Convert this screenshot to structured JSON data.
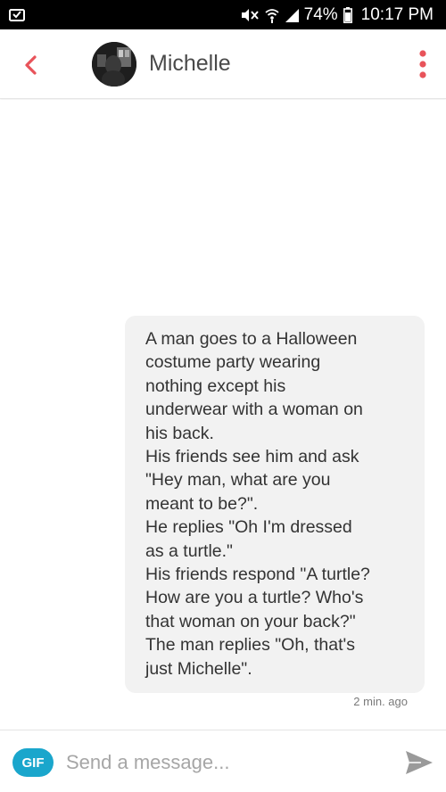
{
  "status_bar": {
    "battery": "74%",
    "time": "10:17 PM"
  },
  "header": {
    "contact_name": "Michelle"
  },
  "messages": [
    {
      "text": "A man goes to a Halloween\ncostume party wearing\nnothing except his\nunderwear with a woman on\nhis back.\nHis friends see him and ask\n\"Hey man, what are you\nmeant to be?\".\nHe replies \"Oh I'm dressed\nas a turtle.\"\nHis friends respond \"A turtle?\nHow are you a turtle? Who's\nthat woman on your back?\"\nThe man replies \"Oh, that's\njust Michelle\".",
      "timestamp": "2 min. ago"
    }
  ],
  "input": {
    "gif_label": "GIF",
    "placeholder": "Send a message..."
  },
  "colors": {
    "accent_back": "#e8535a",
    "gif_button": "#1aa6cc",
    "bubble": "#f2f2f2"
  },
  "icons": [
    "status-notification-icon",
    "mute-icon",
    "wifi-icon",
    "signal-icon",
    "battery-icon",
    "back-chevron-icon",
    "more-vert-icon",
    "send-icon"
  ]
}
